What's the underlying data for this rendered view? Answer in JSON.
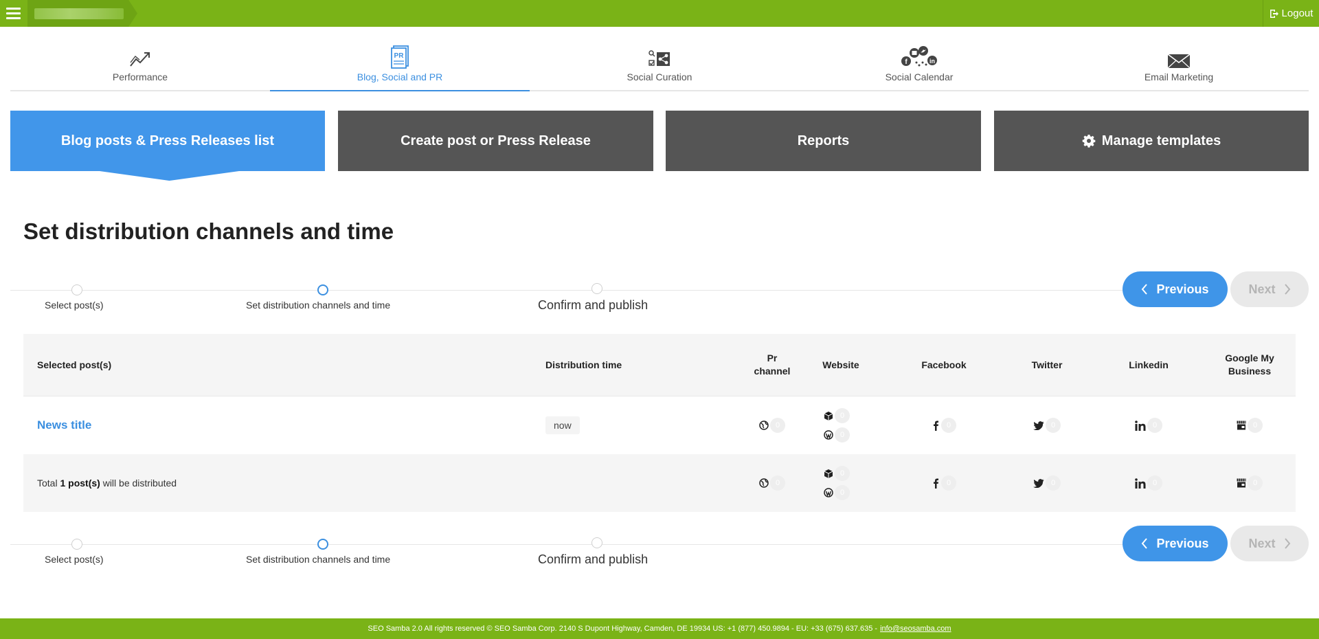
{
  "topbar": {
    "logout_label": "Logout"
  },
  "nav": {
    "tabs": [
      {
        "label": "Performance",
        "icon": "trend-icon"
      },
      {
        "label": "Blog, Social and PR",
        "icon": "pr-document-icon",
        "active": true
      },
      {
        "label": "Social Curation",
        "icon": "share-search-icon"
      },
      {
        "label": "Social Calendar",
        "icon": "social-networks-icon"
      },
      {
        "label": "Email Marketing",
        "icon": "envelope-icon"
      }
    ]
  },
  "actions": {
    "list_label": "Blog posts & Press Releases list",
    "create_label": "Create post or Press Release",
    "reports_label": "Reports",
    "templates_label": "Manage templates"
  },
  "page": {
    "title": "Set distribution channels and time"
  },
  "stepper": {
    "steps": [
      "Select post(s)",
      "Set distribution channels and time",
      "Confirm and publish"
    ],
    "active_index": 1,
    "prev_label": "Previous",
    "next_label": "Next"
  },
  "table": {
    "headers": {
      "selected": "Selected post(s)",
      "time": "Distribution time",
      "pr": "Pr channel",
      "website": "Website",
      "facebook": "Facebook",
      "twitter": "Twitter",
      "linkedin": "Linkedin",
      "gmb": "Google My Business"
    },
    "row": {
      "title": "News title",
      "time": "now",
      "counts": {
        "pr": "0",
        "web_blog": "0",
        "web_wp": "0",
        "facebook": "0",
        "twitter": "0",
        "linkedin": "0",
        "gmb": "0"
      }
    },
    "total": {
      "prefix": "Total",
      "count": "1 post(s)",
      "suffix": "will be distributed",
      "counts": {
        "pr": "0",
        "web_blog": "0",
        "web_wp": "0",
        "facebook": "0",
        "twitter": "0",
        "linkedin": "0",
        "gmb": "0"
      }
    }
  },
  "footer": {
    "text": "SEO Samba 2.0  All rights reserved © SEO Samba Corp. 2140 S Dupont Highway, Camden, DE 19934 US: +1 (877) 450.9894 - EU: +33 (675) 637.635 -",
    "email": "info@seosamba.com"
  },
  "colors": {
    "brand_green": "#7ab317",
    "accent_blue": "#3b8fe0",
    "dark_button": "#555555"
  }
}
